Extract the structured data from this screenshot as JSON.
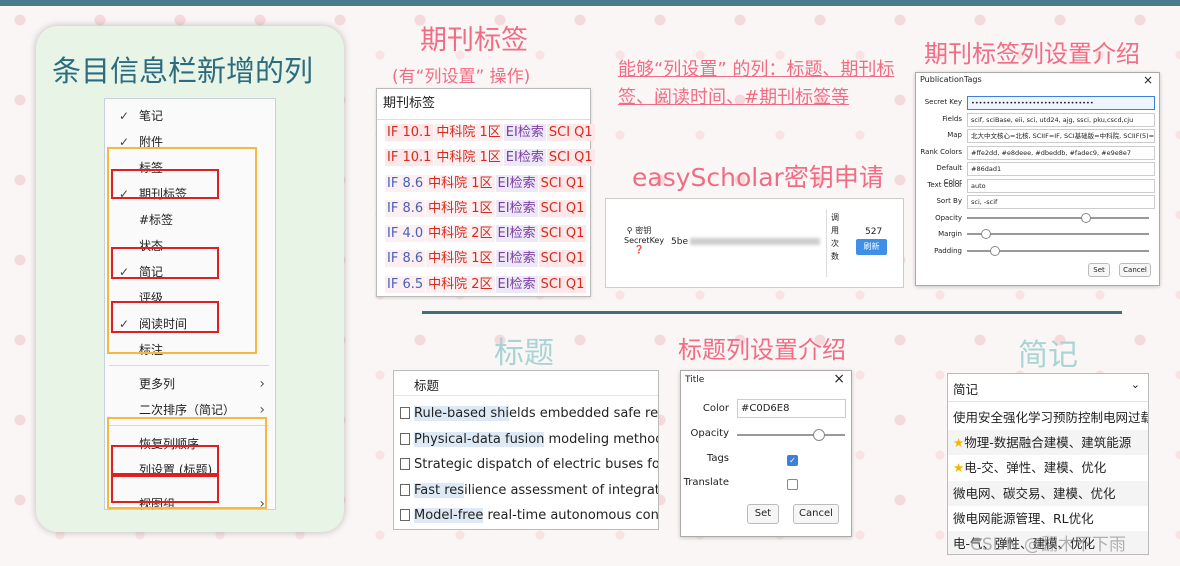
{
  "left_panel": {
    "title": "条目信息栏新增的列",
    "menu_items": [
      {
        "label": "笔记",
        "checked": true
      },
      {
        "label": "附件",
        "checked": true
      },
      {
        "label": "标签",
        "checked": false
      },
      {
        "label": "期刊标签",
        "checked": true
      },
      {
        "label": "#标签",
        "checked": false
      },
      {
        "label": "状态",
        "checked": false
      },
      {
        "label": "简记",
        "checked": true
      },
      {
        "label": "评级",
        "checked": false
      },
      {
        "label": "阅读时间",
        "checked": true
      },
      {
        "label": "标注",
        "checked": false
      },
      {
        "label": "更多列",
        "submenu": true
      },
      {
        "label": "二次排序（简记）",
        "submenu": true
      },
      {
        "label": "恢复列顺序"
      },
      {
        "label": "列设置 (标题)"
      },
      {
        "label": "视图组",
        "submenu": true
      }
    ],
    "check_glyph": "✓",
    "arrow_glyph": "›"
  },
  "journal_tags": {
    "section_title": "期刊标签",
    "section_subtitle": "(有“列设置” 操作)",
    "header": "期刊标签",
    "rows": [
      {
        "if": "IF 10.1",
        "cas": "中科院 1区",
        "ei": "EI检索",
        "sci": "SCI Q1"
      },
      {
        "if": "IF 10.1",
        "cas": "中科院 1区",
        "ei": "EI检索",
        "sci": "SCI Q1"
      },
      {
        "if": "IF 8.6",
        "cas": "中科院 1区",
        "ei": "EI检索",
        "sci": "SCI Q1"
      },
      {
        "if": "IF 8.6",
        "cas": "中科院 1区",
        "ei": "EI检索",
        "sci": "SCI Q1"
      },
      {
        "if": "IF 4.0",
        "cas": "中科院 2区",
        "ei": "EI检索",
        "sci": "SCI Q1"
      },
      {
        "if": "IF 8.6",
        "cas": "中科院 1区",
        "ei": "EI检索",
        "sci": "SCI Q1"
      },
      {
        "if": "IF 6.5",
        "cas": "中科院 2区",
        "ei": "EI检索",
        "sci": "SCI Q1"
      }
    ]
  },
  "description": "能够“列设置” 的列：标题、期刊标签、阅读时间、#期刊标签等",
  "easyscholar": {
    "section_title": "easyScholar密钥申请",
    "key_label_1": "密钥",
    "key_label_2": "SecretKey",
    "key_prefix": "5be",
    "usage_label": "调用次数",
    "usage_count": "527",
    "refresh_label": "刷新"
  },
  "pub_tags_settings": {
    "section_title": "期刊标签列设置介绍",
    "dialog_title": "PublicationTags",
    "fields": [
      {
        "label": "Secret Key",
        "value": "••••••••••••••••••••••••••••••••"
      },
      {
        "label": "Fields",
        "value": "scif, sciBase, eii, sci, utd24, ajg, ssci, pku,cscd,cju"
      },
      {
        "label": "Map",
        "value": "北大中文核心=北核, SCIIF=IF, SCI基础版=中科院, SCIIF(5)=IF"
      },
      {
        "label": "Rank Colors",
        "value": "#ffe2dd, #e8deee, #dbeddb, #fadec9, #e9e8e7"
      },
      {
        "label": "Default Color",
        "value": "#86dad1"
      },
      {
        "label": "Text Color",
        "value": "auto"
      },
      {
        "label": "Sort By",
        "value": "sci, -scif"
      }
    ],
    "sliders": [
      {
        "label": "Opacity",
        "level": 0.65
      },
      {
        "label": "Margin",
        "level": 0.1
      },
      {
        "label": "Padding",
        "level": 0.15
      }
    ],
    "set_label": "Set",
    "cancel_label": "Cancel"
  },
  "title_section": {
    "section_title": "标题",
    "header": "标题",
    "rows": [
      {
        "hl": "Rule-based shi",
        "rest": "elds embedded safe reinfo"
      },
      {
        "hl": "Physical-data fusion",
        "rest": " modeling method fo"
      },
      {
        "hl": "",
        "rest": "Strategic dispatch of electric buses for res"
      },
      {
        "hl": "Fast res",
        "rest": "ilience assessment of integrated e"
      },
      {
        "hl": "Model-free",
        "rest": " real-time autonomous contro"
      }
    ]
  },
  "title_settings": {
    "section_title": "标题列设置介绍",
    "dialog_title": "Title",
    "color_label": "Color",
    "color_value": "#C0D6E8",
    "opacity_label": "Opacity",
    "opacity_level": 0.75,
    "tags_label": "Tags",
    "tags_checked": true,
    "translate_label": "Translate",
    "translate_checked": false,
    "set_label": "Set",
    "cancel_label": "Cancel"
  },
  "notes_section": {
    "section_title": "简记",
    "header": "简记",
    "rows": [
      {
        "text": "使用安全强化学习预防控制电网过载",
        "star": false
      },
      {
        "text": "物理-数据融合建模、建筑能源",
        "star": true
      },
      {
        "text": "电-交、弹性、建模、优化",
        "star": true
      },
      {
        "text": "微电网、碳交易、建模、优化",
        "star": false
      },
      {
        "text": "微电网能源管理、RL优化",
        "star": false
      },
      {
        "text": "电-气、弹性、建模、优化",
        "star": false
      }
    ]
  },
  "watermark": "CSDN @翻木不下雨",
  "colors": {
    "accent_pink": "#f06d84",
    "accent_teal": "#a8d4d4",
    "title_blue": "#2d6b7f",
    "highlight_box": "#e02020",
    "group_box": "#f5b942"
  }
}
